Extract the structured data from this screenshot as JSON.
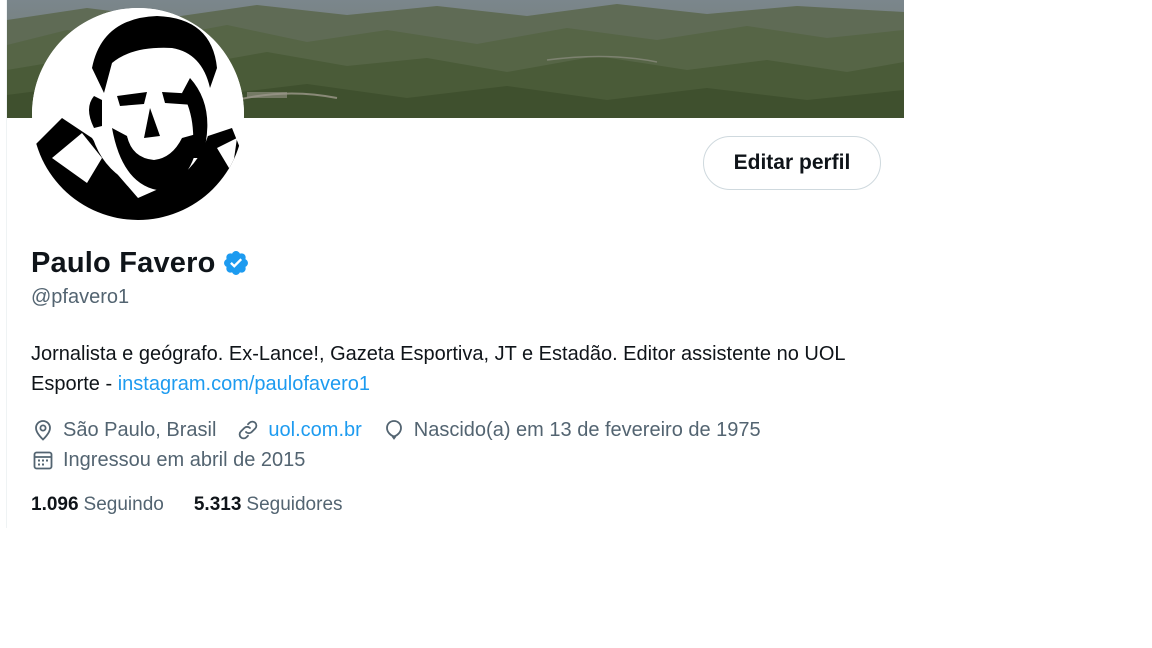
{
  "profile": {
    "name": "Paulo Favero",
    "handle": "@pfavero1",
    "bio_text": "Jornalista e geógrafo. Ex-Lance!, Gazeta Esportiva, JT e Estadão. Editor assistente no UOL Esporte - ",
    "bio_link": "instagram.com/paulofavero1",
    "location": "São Paulo, Brasil",
    "website": "uol.com.br",
    "birthday": "Nascido(a) em 13 de fevereiro de 1975",
    "joined": "Ingressou em abril de 2015",
    "following_count": "1.096",
    "following_label": "Seguindo",
    "followers_count": "5.313",
    "followers_label": "Seguidores",
    "edit_button": "Editar perfil",
    "icons": {
      "verified": "verified-badge-icon",
      "location": "location-pin-icon",
      "website": "link-icon",
      "birthday": "balloon-icon",
      "joined": "calendar-icon"
    }
  },
  "colors": {
    "link": "#1d9bf0",
    "text_primary": "#0f1419",
    "text_secondary": "#536471",
    "verified": "#1d9bf0",
    "button_border": "#cfd9de"
  }
}
